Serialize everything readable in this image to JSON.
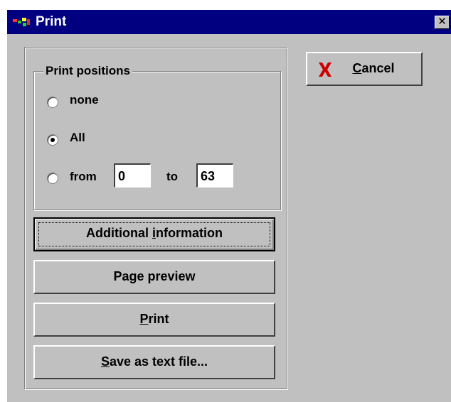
{
  "window": {
    "title": "Print",
    "close_glyph": "✕"
  },
  "print_positions": {
    "legend": "Print positions",
    "options": [
      {
        "label": "none",
        "selected": false
      },
      {
        "label": "All",
        "selected": true
      },
      {
        "label": "from",
        "selected": false
      }
    ],
    "from_value": "0",
    "to_label": "to",
    "to_value": "63"
  },
  "buttons": {
    "cancel": {
      "pre": "",
      "key": "C",
      "post": "ancel",
      "icon": "x-cross-icon",
      "icon_color": "#cc0000"
    },
    "additional_info": {
      "pre": "Additional ",
      "key": "i",
      "post": "nformation"
    },
    "page_preview": {
      "pre": "Pa",
      "key": "g",
      "post": "e preview"
    },
    "print": {
      "pre": "",
      "key": "P",
      "post": "rint"
    },
    "save_text": {
      "pre": "",
      "key": "S",
      "post": "ave as text file..."
    }
  },
  "colors": {
    "titlebar": "#000080",
    "face": "#c0c0c0"
  }
}
